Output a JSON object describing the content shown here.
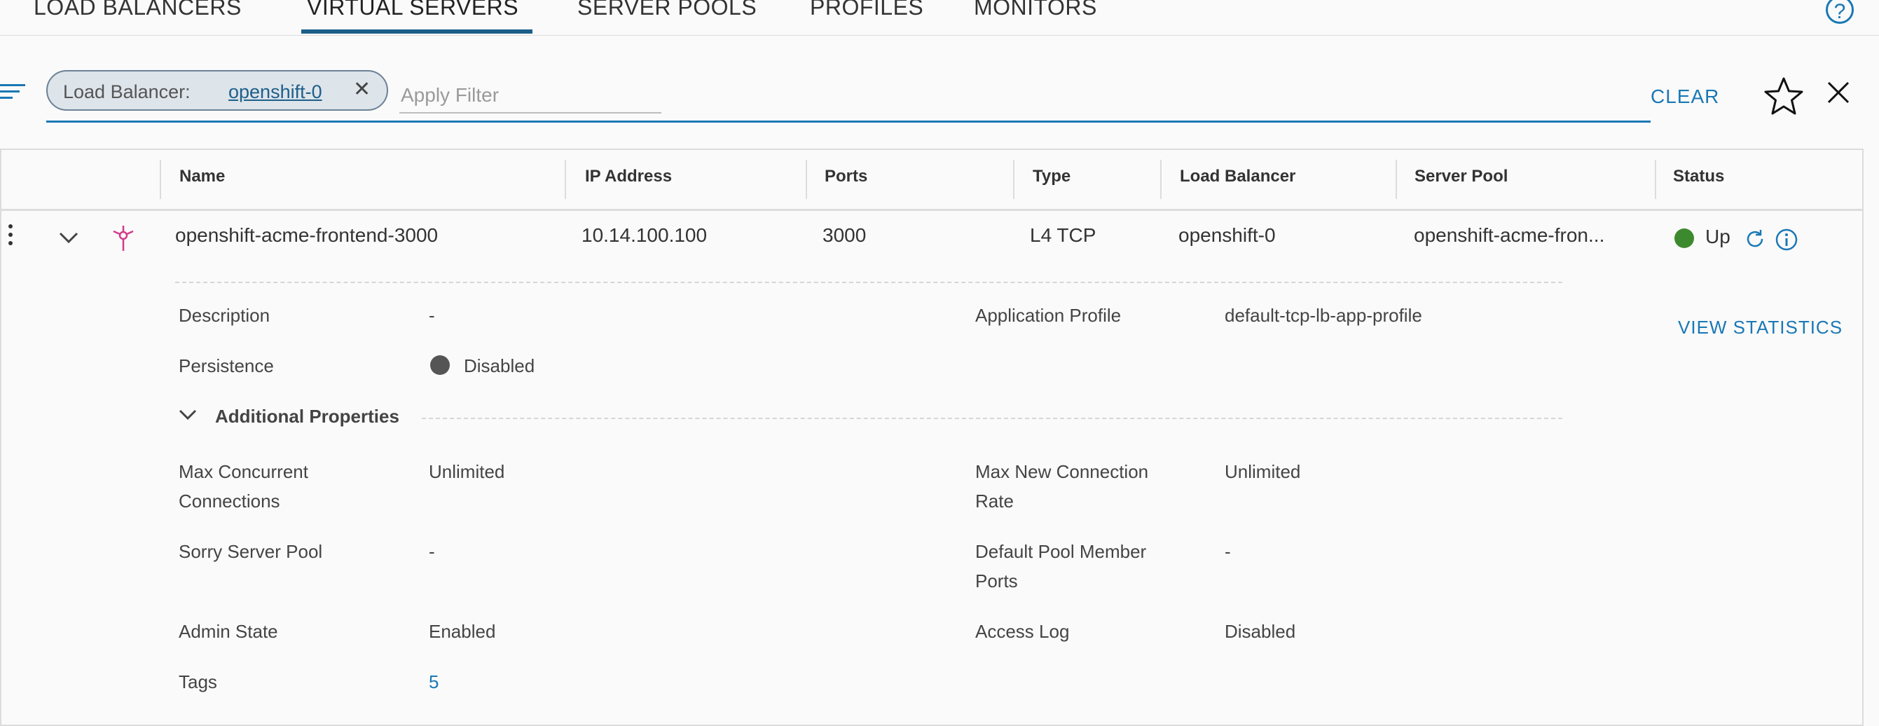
{
  "tabs": [
    {
      "label": "LOAD BALANCERS",
      "active": false
    },
    {
      "label": "VIRTUAL SERVERS",
      "active": true
    },
    {
      "label": "SERVER POOLS",
      "active": false
    },
    {
      "label": "PROFILES",
      "active": false
    },
    {
      "label": "MONITORS",
      "active": false
    }
  ],
  "help_icon": "question-circle-icon",
  "filter": {
    "chip_key": "Load Balancer:",
    "chip_value": "openshift-0",
    "placeholder": "Apply Filter",
    "clear_label": "CLEAR"
  },
  "table": {
    "columns": [
      "Name",
      "IP Address",
      "Ports",
      "Type",
      "Load Balancer",
      "Server Pool",
      "Status"
    ],
    "row": {
      "name": "openshift-acme-frontend-3000",
      "ip": "10.14.100.100",
      "ports": "3000",
      "type": "L4 TCP",
      "load_balancer": "openshift-0",
      "server_pool": "openshift-acme-fron...",
      "status": "Up"
    }
  },
  "details": {
    "description_label": "Description",
    "description_value": "-",
    "persistence_label": "Persistence",
    "persistence_value": "Disabled",
    "app_profile_label": "Application Profile",
    "app_profile_value": "default-tcp-lb-app-profile",
    "view_statistics": "VIEW STATISTICS",
    "additional_properties": "Additional Properties",
    "max_concurrent_label_1": "Max Concurrent",
    "max_concurrent_label_2": "Connections",
    "max_concurrent_value": "Unlimited",
    "max_new_conn_label_1": "Max New Connection",
    "max_new_conn_label_2": "Rate",
    "max_new_conn_value": "Unlimited",
    "sorry_pool_label": "Sorry Server Pool",
    "sorry_pool_value": "-",
    "default_ports_label_1": "Default Pool Member",
    "default_ports_label_2": "Ports",
    "default_ports_value": "-",
    "admin_state_label": "Admin State",
    "admin_state_value": "Enabled",
    "access_log_label": "Access Log",
    "access_log_value": "Disabled",
    "tags_label": "Tags",
    "tags_value": "5"
  },
  "colors": {
    "accent": "#1a78b5",
    "status_up": "#3d8a2e",
    "persistence_dot": "#555555",
    "server_icon": "#d23b8a"
  }
}
